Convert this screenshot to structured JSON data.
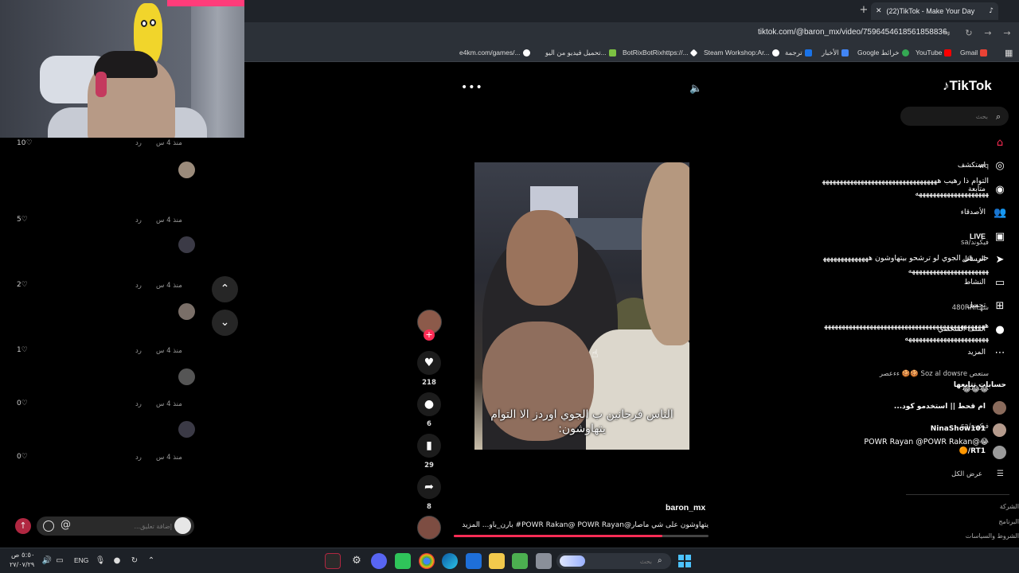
{
  "browser": {
    "tab_title": "(22)TikTok - Make Your Day",
    "url": "tiktok.com/@baron_mx/video/7596454618561858836",
    "bookmarks": [
      {
        "label": "Gmail",
        "color": "#ea4335"
      },
      {
        "label": "YouTube",
        "color": "#ff0000"
      },
      {
        "label": "Google خرائط",
        "color": "#34a853"
      },
      {
        "label": "الأخبار",
        "color": "#4285f4"
      },
      {
        "label": "ترجمة",
        "color": "#1a73e8"
      },
      {
        "label": "Steam Workshop:Ar...",
        "color": "#ffffff"
      },
      {
        "label": "BotRixBotRixhttps://...",
        "color": "#ffffff"
      },
      {
        "label": "تحميل فيديو من اليو...",
        "color": "#7cc242"
      },
      {
        "label": "e4km.com/games/...",
        "color": "#ffffff"
      }
    ]
  },
  "comments": [
    {
      "likes": "10",
      "time": "منذ 4 س",
      "reply": "رد",
      "user": "",
      "text": ""
    },
    {
      "likes": "5",
      "time": "منذ 4 س",
      "reply": "رد",
      "user": "wq",
      "text": "التوام ذا رهيب ههههههههههههههههههههههههههههههههههههههههههههههههههههههه"
    },
    {
      "likes": "2",
      "time": "منذ 4 س",
      "reply": "رد",
      "user": "فيكوند/sa",
      "text": "حتى في الجوي لو ترشحو بيتهاوشون ههههههههههههههههههههههههههههههههههههه"
    },
    {
      "likes": "1",
      "time": "منذ 4 س",
      "reply": "رد",
      "user": "شهـ480RRll",
      "text": "ههههههههههههههههههههههههههههههههههههههههههههههههههههههههههههههههههههههه"
    },
    {
      "likes": "0",
      "time": "منذ 4 س",
      "reply": "رد",
      "user": "ستعص Soz al dowsre 🍪🍪 ءءعصر",
      "text": "😂😂😂"
    },
    {
      "likes": "0",
      "time": "منذ 4 س",
      "reply": "رد",
      "user": "فيكوند/sa",
      "text": "😂@POWR Rayan @POWR Rakan"
    }
  ],
  "comment_input": {
    "placeholder": "إضافة تعليق..."
  },
  "video": {
    "caption": "الناس فرحانين ب الجوي اوردز الا التوام يتهاوشون:",
    "author": "baron_mx",
    "description": "يتهاوشون على شي ماصار@POWR Rakan@ POWR Rayan# بارن_باو... المزيد",
    "likes": "218",
    "comments": "6",
    "saves": "29",
    "shares": "8",
    "progress": 0.82
  },
  "sidebar": {
    "logo": "TikTok",
    "search_placeholder": "بحث",
    "nav": [
      {
        "label": "",
        "icon": "home-icon",
        "glyph": "⌂",
        "color": "#fe2c55",
        "badge": ""
      },
      {
        "label": "استكشف",
        "icon": "compass-icon",
        "glyph": "◎",
        "color": "#ffffff",
        "badge": ""
      },
      {
        "label": "متابعة",
        "icon": "following-icon",
        "glyph": "◉",
        "color": "#ffffff",
        "badge": ""
      },
      {
        "label": "الأصدقاء",
        "icon": "friends-icon",
        "glyph": "👥",
        "color": "#ffffff",
        "badge": ""
      },
      {
        "label": "LIVE",
        "icon": "live-icon",
        "glyph": "▣",
        "color": "#ffffff",
        "badge": ""
      },
      {
        "label": "الرسائل",
        "icon": "messages-icon",
        "glyph": "➤",
        "color": "#ffffff",
        "badge": ""
      },
      {
        "label": "النشاط",
        "icon": "activity-icon",
        "glyph": "▭",
        "color": "#ffffff",
        "badge": ""
      },
      {
        "label": "تحميل",
        "icon": "upload-icon",
        "glyph": "⊞",
        "color": "#ffffff",
        "badge": ""
      },
      {
        "label": "الملف الشخصي",
        "icon": "profile-icon",
        "glyph": "●",
        "color": "#ffffff",
        "badge": ""
      },
      {
        "label": "المزيد",
        "icon": "more-icon",
        "glyph": "⋯",
        "color": "#ffffff",
        "badge": ""
      }
    ],
    "following_title": "حسابات تتابعها",
    "following": [
      {
        "name": "ام قحط || استخدمو كود..."
      },
      {
        "name": "NinaShow101"
      },
      {
        "name": "RT1/🟠"
      }
    ],
    "see_all": "عرض الكل",
    "footer": [
      "الشركة",
      "البرنامج",
      "الشروط والسياسات"
    ]
  },
  "taskbar": {
    "time": "٥:٥٠ ص",
    "date": "٢٧/٠٧/٢٩",
    "lang": "ENG",
    "search_placeholder": "بحث"
  }
}
